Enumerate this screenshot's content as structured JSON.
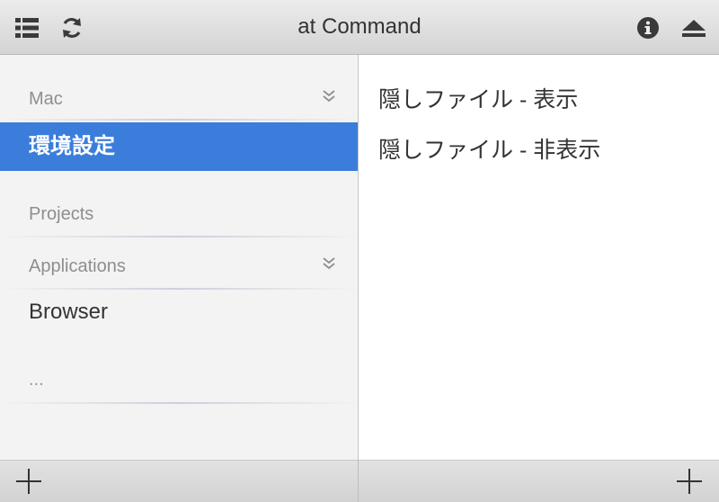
{
  "window": {
    "title": "at Command"
  },
  "toolbar": {
    "left_icons": [
      "list-icon",
      "refresh-icon"
    ],
    "right_icons": [
      "info-icon",
      "eject-icon"
    ]
  },
  "sidebar": {
    "sections": [
      {
        "header": "Mac",
        "collapsible": true,
        "items": [
          {
            "label": "環境設定",
            "selected": true
          }
        ]
      },
      {
        "header": "Projects",
        "collapsible": false,
        "items": []
      },
      {
        "header": "Applications",
        "collapsible": true,
        "items": [
          {
            "label": "Browser",
            "selected": false
          }
        ]
      }
    ],
    "more_label": "..."
  },
  "content": {
    "commands": [
      {
        "label": "隠しファイル - 表示"
      },
      {
        "label": "隠しファイル - 非表示"
      }
    ]
  },
  "footer": {
    "left_add_icon": "plus-icon",
    "right_add_icon": "plus-icon"
  },
  "colors": {
    "selection": "#3a7ddb",
    "header_text": "#8e8e8e",
    "body_text": "#333333"
  }
}
